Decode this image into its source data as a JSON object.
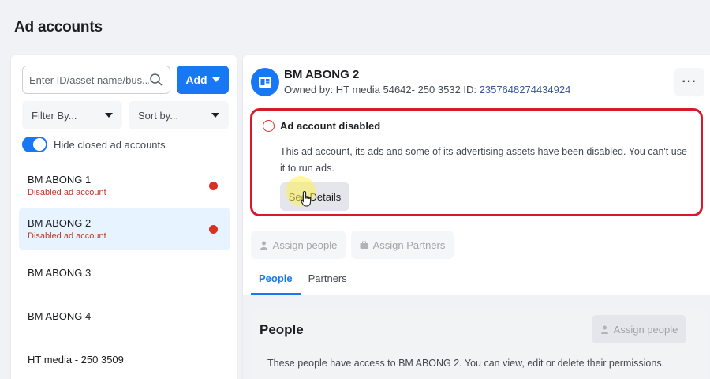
{
  "page": {
    "title": "Ad accounts"
  },
  "left_panel": {
    "search": {
      "placeholder": "Enter ID/asset name/bus..."
    },
    "add_label": "Add",
    "filter_label": "Filter By...",
    "sort_label": "Sort by...",
    "toggle_label": "Hide closed ad accounts",
    "accounts": [
      {
        "name": "BM ABONG 1",
        "status": "Disabled ad account"
      },
      {
        "name": "BM ABONG 2",
        "status": "Disabled ad account"
      },
      {
        "name": "BM ABONG 3",
        "status": ""
      },
      {
        "name": "BM ABONG 4",
        "status": ""
      },
      {
        "name": "HT media - 250 3509",
        "status": ""
      }
    ]
  },
  "detail": {
    "name": "BM ABONG 2",
    "owner_prefix": "Owned by: HT media 54642- 250 3532  ID: ",
    "id": "2357648274434924",
    "alert": {
      "title": "Ad account disabled",
      "body": "This ad account, its ads and some of its advertising assets have been disabled. You can't use it to run ads.",
      "button_label": "See Details"
    },
    "assign_people_label": "Assign people",
    "assign_partners_label": "Assign Partners",
    "tabs": [
      {
        "label": "People"
      },
      {
        "label": "Partners"
      }
    ],
    "people_section": {
      "title": "People",
      "assign_label": "Assign people",
      "description": "These people have access to BM ABONG 2. You can view, edit or delete their permissions."
    }
  },
  "colors": {
    "accent": "#1877f2",
    "danger": "#d93025",
    "alert_border": "#d7192b"
  }
}
